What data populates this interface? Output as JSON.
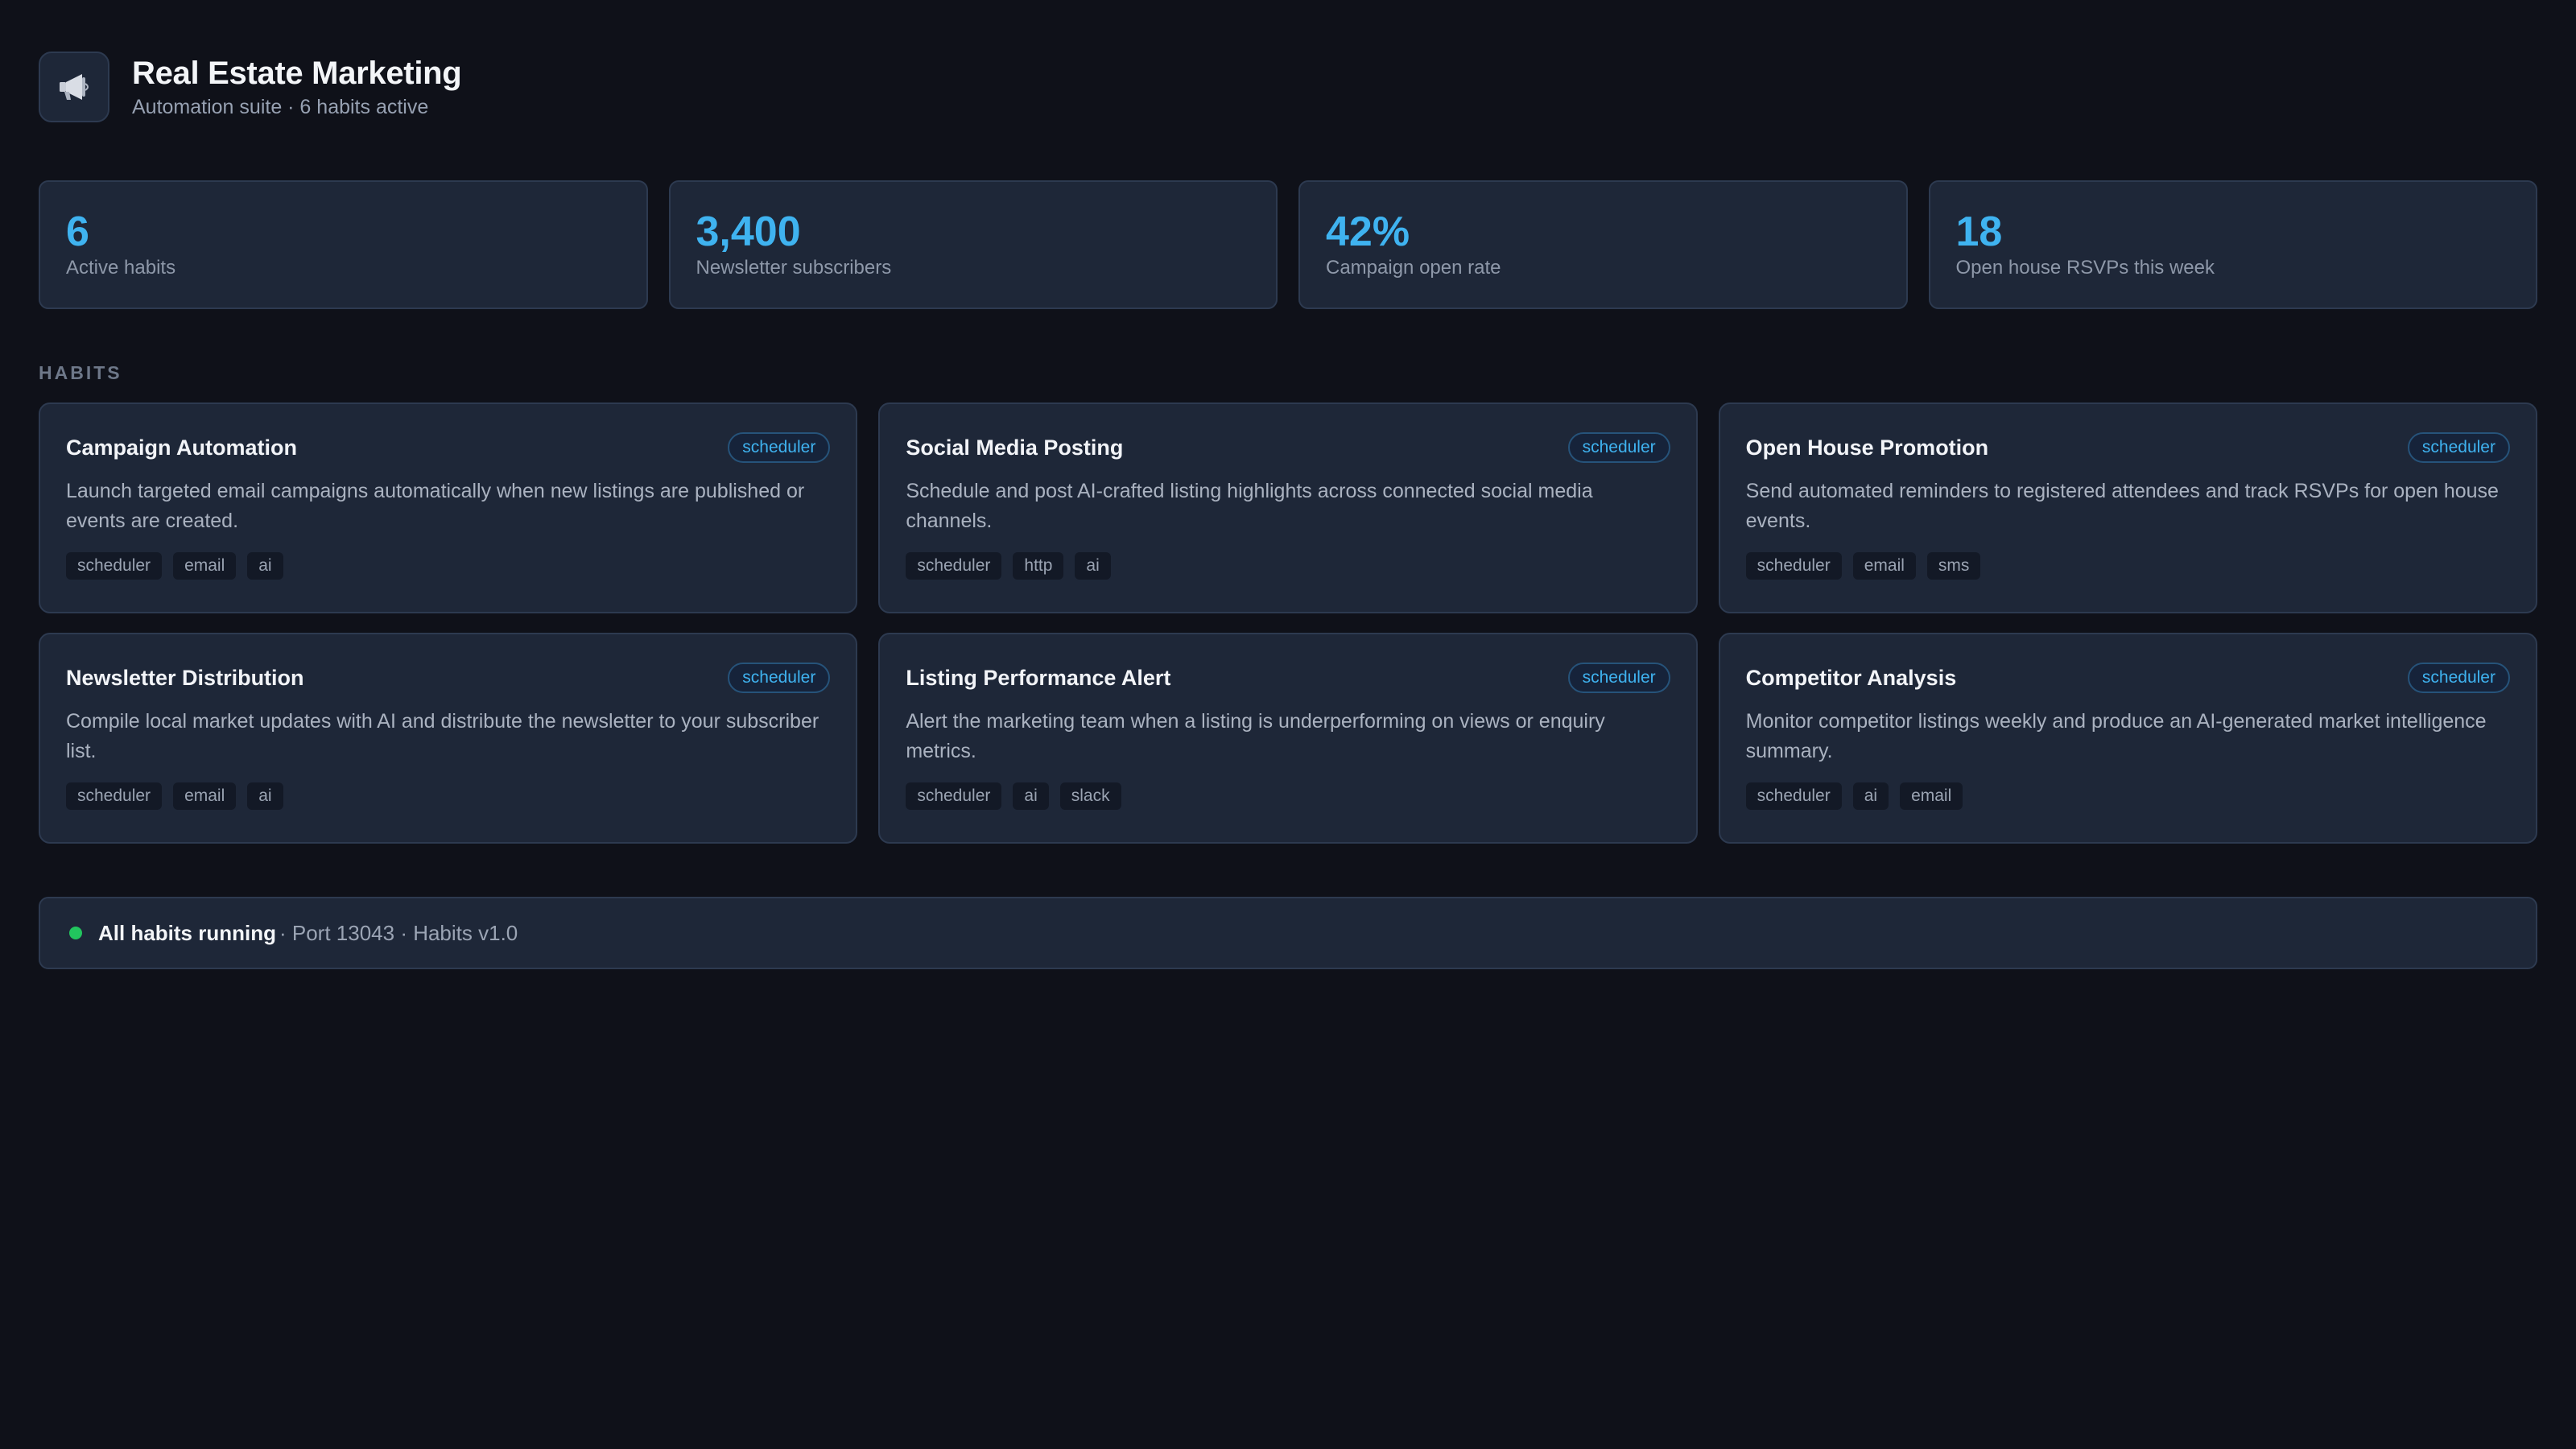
{
  "header": {
    "icon": "megaphone-icon",
    "title": "Real Estate Marketing",
    "subtitle": "Automation suite · 6 habits active"
  },
  "stats": [
    {
      "value": "6",
      "label": "Active habits"
    },
    {
      "value": "3,400",
      "label": "Newsletter subscribers"
    },
    {
      "value": "42%",
      "label": "Campaign open rate"
    },
    {
      "value": "18",
      "label": "Open house RSVPs this week"
    }
  ],
  "section_label": "HABITS",
  "habits": [
    {
      "title": "Campaign Automation",
      "badge": "scheduler",
      "description": "Launch targeted email campaigns automatically when new listings are published or events are created.",
      "tags": [
        "scheduler",
        "email",
        "ai"
      ]
    },
    {
      "title": "Social Media Posting",
      "badge": "scheduler",
      "description": "Schedule and post AI-crafted listing highlights across connected social media channels.",
      "tags": [
        "scheduler",
        "http",
        "ai"
      ]
    },
    {
      "title": "Open House Promotion",
      "badge": "scheduler",
      "description": "Send automated reminders to registered attendees and track RSVPs for open house events.",
      "tags": [
        "scheduler",
        "email",
        "sms"
      ]
    },
    {
      "title": "Newsletter Distribution",
      "badge": "scheduler",
      "description": "Compile local market updates with AI and distribute the newsletter to your subscriber list.",
      "tags": [
        "scheduler",
        "email",
        "ai"
      ]
    },
    {
      "title": "Listing Performance Alert",
      "badge": "scheduler",
      "description": "Alert the marketing team when a listing is underperforming on views or enquiry metrics.",
      "tags": [
        "scheduler",
        "ai",
        "slack"
      ]
    },
    {
      "title": "Competitor Analysis",
      "badge": "scheduler",
      "description": "Monitor competitor listings weekly and produce an AI-generated market intelligence summary.",
      "tags": [
        "scheduler",
        "ai",
        "email"
      ]
    }
  ],
  "status": {
    "main": "All habits running",
    "rest": "· Port 13043 · Habits v1.0",
    "dot_color": "#22c55e"
  },
  "colors": {
    "background": "#0f1119",
    "card": "#1e2738",
    "accent": "#3fb3f0",
    "success": "#22c55e"
  }
}
